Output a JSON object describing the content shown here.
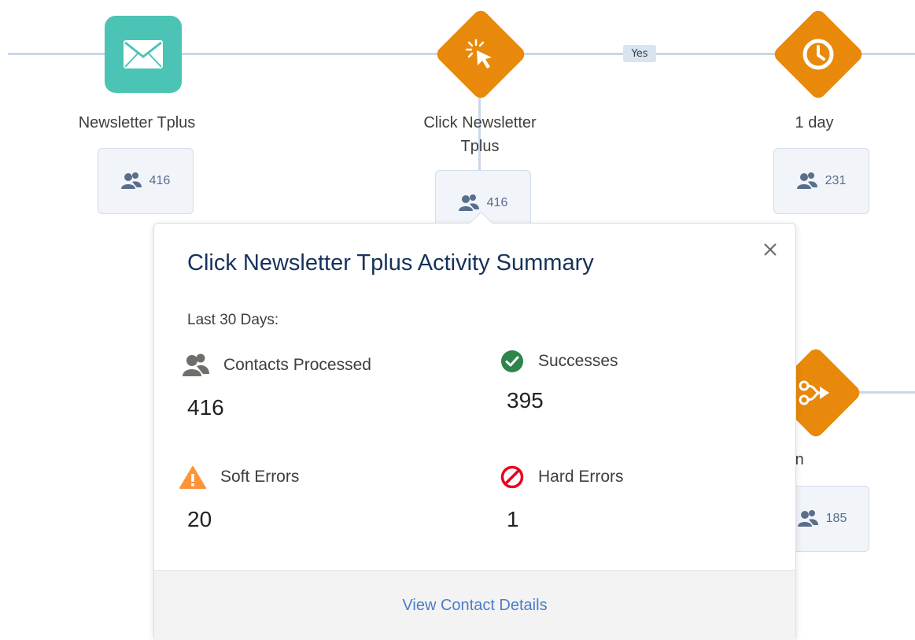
{
  "nodes": {
    "newsletter": {
      "label": "Newsletter Tplus",
      "count": "416",
      "icon": "envelope-icon"
    },
    "click": {
      "label_line1": "Click Newsletter",
      "label_line2": "Tplus",
      "count": "416",
      "icon": "cursor-click-icon"
    },
    "wait": {
      "label": "1 day",
      "count": "231",
      "icon": "clock-icon"
    },
    "join": {
      "label": "Join",
      "count": "185",
      "icon": "join-icon"
    }
  },
  "connector": {
    "yes_label": "Yes"
  },
  "popover": {
    "title": "Click Newsletter Tplus Activity Summary",
    "period": "Last 30 Days:",
    "stats": {
      "contacts": {
        "label": "Contacts Processed",
        "value": "416"
      },
      "successes": {
        "label": "Successes",
        "value": "395"
      },
      "soft_errors": {
        "label": "Soft Errors",
        "value": "20"
      },
      "hard_errors": {
        "label": "Hard Errors",
        "value": "1"
      }
    },
    "footer_link": "View Contact Details"
  },
  "colors": {
    "email_node": "#4bc4b6",
    "decision_node": "#e8890b",
    "connector": "#c9d8ea",
    "success": "#2e844a",
    "warning": "#fe9339",
    "error": "#ea001e",
    "link": "#4a7dc9",
    "title": "#16325c"
  }
}
